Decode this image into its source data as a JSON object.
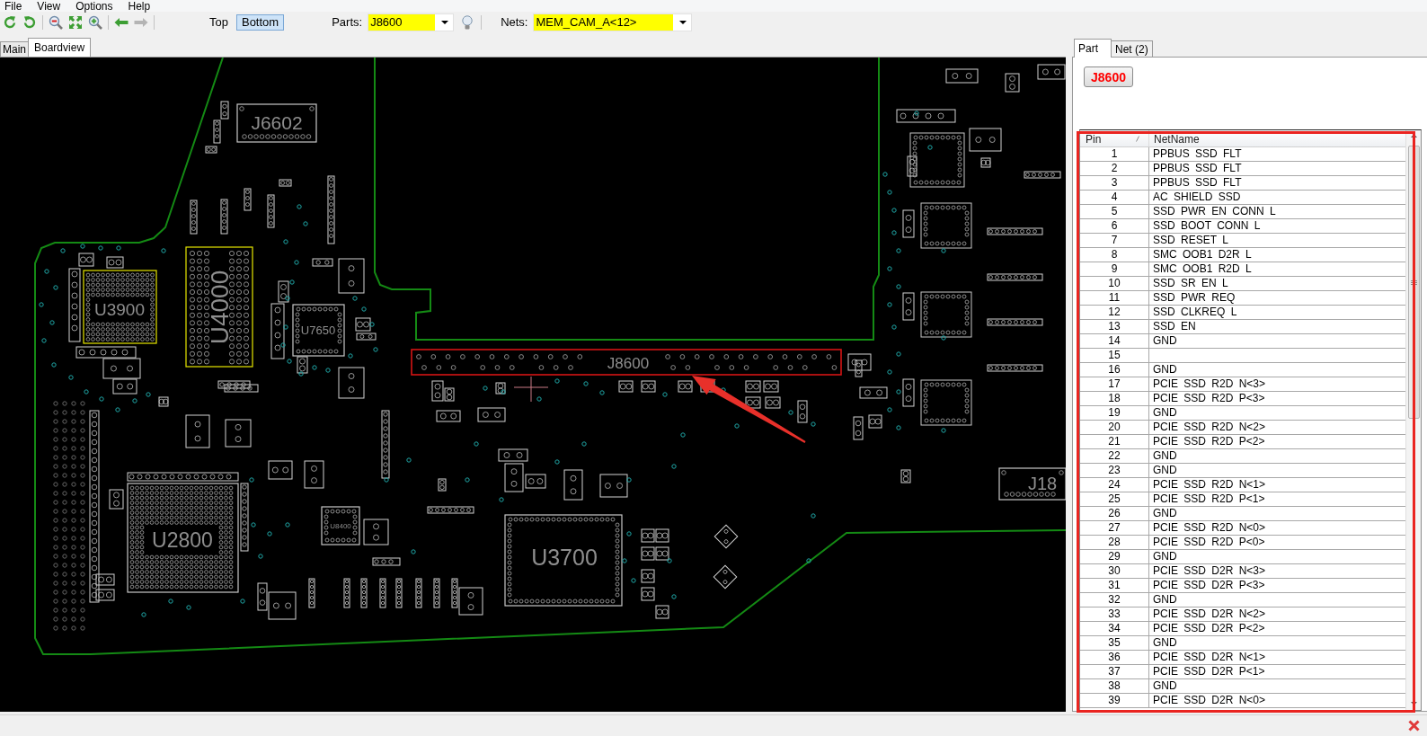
{
  "menu": [
    {
      "label": "File"
    },
    {
      "label": "View"
    },
    {
      "label": "Options"
    },
    {
      "label": "Help"
    }
  ],
  "toolbar": {
    "button_groups": [
      [
        {
          "kind": "rotate-left",
          "disabled": false
        },
        {
          "kind": "rotate-right",
          "disabled": false
        }
      ],
      [
        {
          "kind": "zoom-out",
          "disabled": false
        },
        {
          "kind": "fit",
          "disabled": false
        },
        {
          "kind": "zoom-in",
          "disabled": false
        }
      ],
      [
        {
          "kind": "back",
          "disabled": false
        },
        {
          "kind": "forward",
          "disabled": true
        }
      ]
    ],
    "side": [
      {
        "label": "Top",
        "selected": false
      },
      {
        "label": "Bottom",
        "selected": true
      }
    ],
    "parts": {
      "label": "Parts:",
      "value": "J8600"
    },
    "nets": {
      "label": "Nets:",
      "value": "MEM_CAM_A<12>"
    }
  },
  "document_tabs": [
    {
      "label": "Main",
      "selected": false
    },
    {
      "label": "Boardview",
      "selected": true
    }
  ],
  "board": {
    "components": [
      {
        "label": "J6602",
        "selected": false,
        "highlighted": false
      },
      {
        "label": "U3900",
        "selected": false,
        "highlighted": true
      },
      {
        "label": "U4000",
        "selected": false,
        "highlighted": true
      },
      {
        "label": "U7650",
        "selected": false,
        "highlighted": false
      },
      {
        "label": "J8600",
        "selected": true,
        "highlighted": false
      },
      {
        "label": "U8400",
        "selected": false,
        "highlighted": false
      },
      {
        "label": "U2800",
        "selected": false,
        "highlighted": false
      },
      {
        "label": "U3700",
        "selected": false,
        "highlighted": false
      },
      {
        "label": "J18",
        "selected": false,
        "highlighted": false
      }
    ]
  },
  "panel": {
    "tabs": [
      {
        "label": "Part",
        "selected": true
      },
      {
        "label": "Net (2)",
        "selected": false
      }
    ],
    "part_button": "J8600",
    "table": {
      "columns": [
        {
          "label": "Pin",
          "sorted": true
        },
        {
          "label": "NetName",
          "sorted": false
        }
      ],
      "rows": [
        {
          "pin": "1",
          "net_name": "PPBUS SSD FLT"
        },
        {
          "pin": "2",
          "net_name": "PPBUS SSD FLT"
        },
        {
          "pin": "3",
          "net_name": "PPBUS SSD FLT"
        },
        {
          "pin": "4",
          "net_name": "AC SHIELD SSD"
        },
        {
          "pin": "5",
          "net_name": "SSD PWR EN CONN L"
        },
        {
          "pin": "6",
          "net_name": "SSD BOOT CONN L"
        },
        {
          "pin": "7",
          "net_name": "SSD RESET L"
        },
        {
          "pin": "8",
          "net_name": "SMC OOB1 D2R L"
        },
        {
          "pin": "9",
          "net_name": "SMC OOB1 R2D L"
        },
        {
          "pin": "10",
          "net_name": "SSD SR EN L"
        },
        {
          "pin": "11",
          "net_name": "SSD PWR REQ"
        },
        {
          "pin": "12",
          "net_name": "SSD CLKREQ L"
        },
        {
          "pin": "13",
          "net_name": "SSD EN"
        },
        {
          "pin": "14",
          "net_name": "GND"
        },
        {
          "pin": "15"
        },
        {
          "pin": "16",
          "net_name": "GND"
        },
        {
          "pin": "17",
          "net_name": "PCIE SSD R2D N<3>"
        },
        {
          "pin": "18",
          "net_name": "PCIE SSD R2D P<3>"
        },
        {
          "pin": "19",
          "net_name": "GND"
        },
        {
          "pin": "20",
          "net_name": "PCIE SSD R2D N<2>"
        },
        {
          "pin": "21",
          "net_name": "PCIE SSD R2D P<2>"
        },
        {
          "pin": "22",
          "net_name": "GND"
        },
        {
          "pin": "23",
          "net_name": "GND"
        },
        {
          "pin": "24",
          "net_name": "PCIE SSD R2D N<1>"
        },
        {
          "pin": "25",
          "net_name": "PCIE SSD R2D P<1>"
        },
        {
          "pin": "26",
          "net_name": "GND"
        },
        {
          "pin": "27",
          "net_name": "PCIE SSD R2D N<0>"
        },
        {
          "pin": "28",
          "net_name": "PCIE SSD R2D P<0>"
        },
        {
          "pin": "29",
          "net_name": "GND"
        },
        {
          "pin": "30",
          "net_name": "PCIE SSD D2R N<3>"
        },
        {
          "pin": "31",
          "net_name": "PCIE SSD D2R P<3>"
        },
        {
          "pin": "32",
          "net_name": "GND"
        },
        {
          "pin": "33",
          "net_name": "PCIE SSD D2R N<2>"
        },
        {
          "pin": "34",
          "net_name": "PCIE SSD D2R P<2>"
        },
        {
          "pin": "35",
          "net_name": "GND"
        },
        {
          "pin": "36",
          "net_name": "PCIE SSD D2R N<1>"
        },
        {
          "pin": "37",
          "net_name": "PCIE SSD D2R P<1>"
        },
        {
          "pin": "38",
          "net_name": "GND"
        },
        {
          "pin": "39",
          "net_name": "PCIE SSD D2R N<0>"
        }
      ]
    }
  }
}
